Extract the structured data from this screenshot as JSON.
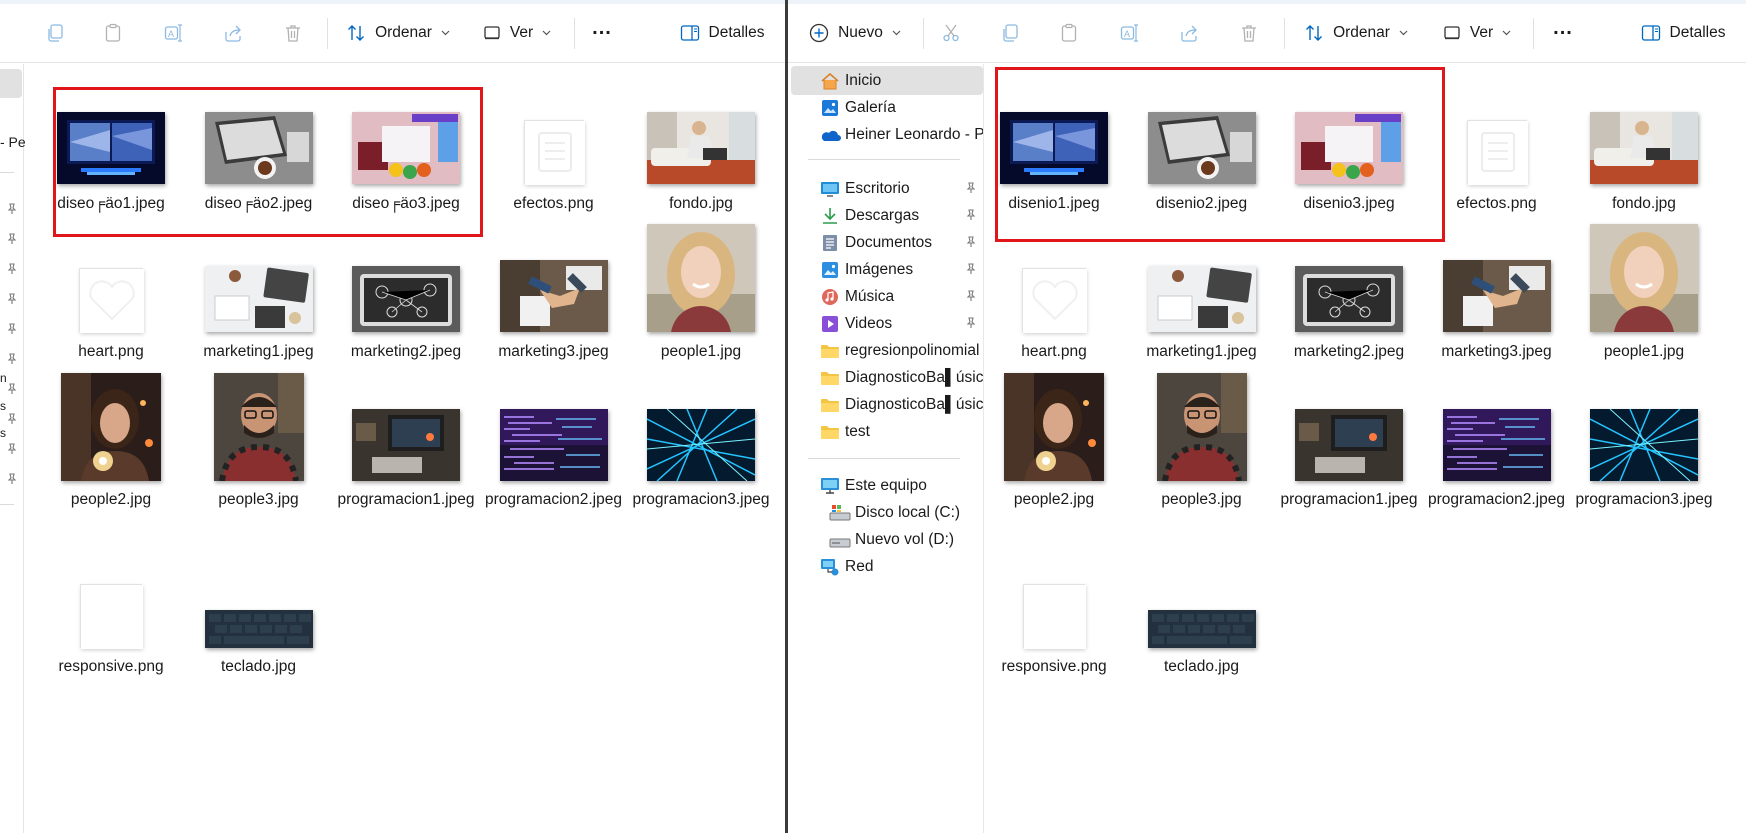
{
  "left_window": {
    "toolbar": {
      "sort": "Ordenar",
      "view": "Ver",
      "more": "...",
      "details": "Detalles"
    },
    "side_fragments": [
      "- Pe",
      "n",
      "s",
      "s"
    ],
    "files": [
      {
        "name": "diseo╒äo1.jpeg",
        "thumb": "monitor"
      },
      {
        "name": "diseo╒äo2.jpeg",
        "thumb": "laptop-coffee"
      },
      {
        "name": "diseo╒äo3.jpeg",
        "thumb": "colors"
      },
      {
        "name": "efectos.png",
        "thumb": "blank-doc"
      },
      {
        "name": "fondo.jpg",
        "thumb": "woman-sofa"
      },
      {
        "name": "heart.png",
        "thumb": "heart"
      },
      {
        "name": "marketing1.jpeg",
        "thumb": "desk-top"
      },
      {
        "name": "marketing2.jpeg",
        "thumb": "tablet-diagram"
      },
      {
        "name": "marketing3.jpeg",
        "thumb": "handshake"
      },
      {
        "name": "people1.jpg",
        "thumb": "blonde"
      },
      {
        "name": "people2.jpg",
        "thumb": "woman-sparkler"
      },
      {
        "name": "people3.jpg",
        "thumb": "man-glasses"
      },
      {
        "name": "programacion1.jpeg",
        "thumb": "dark-laptop"
      },
      {
        "name": "programacion2.jpeg",
        "thumb": "code-purple"
      },
      {
        "name": "programacion3.jpeg",
        "thumb": "neon-lines"
      },
      {
        "name": "responsive.png",
        "thumb": "blank"
      },
      {
        "name": "teclado.jpg",
        "thumb": "keyboard"
      }
    ]
  },
  "right_window": {
    "toolbar": {
      "new": "Nuevo",
      "sort": "Ordenar",
      "view": "Ver",
      "more": "...",
      "details": "Detalles"
    },
    "nav": [
      {
        "label": "Inicio",
        "icon": "home-icon",
        "selected": true
      },
      {
        "label": "Galería",
        "icon": "gallery-icon"
      },
      {
        "label": "Heiner Leonardo - Pe",
        "icon": "onedrive-icon"
      },
      {
        "label": "Escritorio",
        "icon": "desktop-icon",
        "pinned": true
      },
      {
        "label": "Descargas",
        "icon": "download-icon",
        "pinned": true
      },
      {
        "label": "Documentos",
        "icon": "documents-icon",
        "pinned": true
      },
      {
        "label": "Imágenes",
        "icon": "pictures-icon",
        "pinned": true
      },
      {
        "label": "Música",
        "icon": "music-icon",
        "pinned": true
      },
      {
        "label": "Videos",
        "icon": "videos-icon",
        "pinned": true
      },
      {
        "label": "regresionpolinomial",
        "icon": "folder-icon"
      },
      {
        "label": "DiagnosticoBa▌úsicc",
        "icon": "folder-icon"
      },
      {
        "label": "DiagnosticoBa▌úsicc",
        "icon": "folder-icon"
      },
      {
        "label": "test",
        "icon": "folder-icon"
      },
      {
        "label": "Este equipo",
        "icon": "this-pc-icon"
      },
      {
        "label": "Disco local (C:)",
        "icon": "drive-c-icon"
      },
      {
        "label": "Nuevo vol (D:)",
        "icon": "drive-d-icon"
      },
      {
        "label": "Red",
        "icon": "network-icon"
      }
    ],
    "files": [
      {
        "name": "disenio1.jpeg",
        "thumb": "monitor"
      },
      {
        "name": "disenio2.jpeg",
        "thumb": "laptop-coffee"
      },
      {
        "name": "disenio3.jpeg",
        "thumb": "colors"
      },
      {
        "name": "efectos.png",
        "thumb": "blank-doc"
      },
      {
        "name": "fondo.jpg",
        "thumb": "woman-sofa"
      },
      {
        "name": "heart.png",
        "thumb": "heart"
      },
      {
        "name": "marketing1.jpeg",
        "thumb": "desk-top"
      },
      {
        "name": "marketing2.jpeg",
        "thumb": "tablet-diagram"
      },
      {
        "name": "marketing3.jpeg",
        "thumb": "handshake"
      },
      {
        "name": "people1.jpg",
        "thumb": "blonde"
      },
      {
        "name": "people2.jpg",
        "thumb": "woman-sparkler"
      },
      {
        "name": "people3.jpg",
        "thumb": "man-glasses"
      },
      {
        "name": "programacion1.jpeg",
        "thumb": "dark-laptop"
      },
      {
        "name": "programacion2.jpeg",
        "thumb": "code-purple"
      },
      {
        "name": "programacion3.jpeg",
        "thumb": "neon-lines"
      },
      {
        "name": "responsive.png",
        "thumb": "blank"
      },
      {
        "name": "teclado.jpg",
        "thumb": "keyboard"
      }
    ]
  },
  "highlight_color": "#e0161b",
  "accent_color": "#0067c0"
}
